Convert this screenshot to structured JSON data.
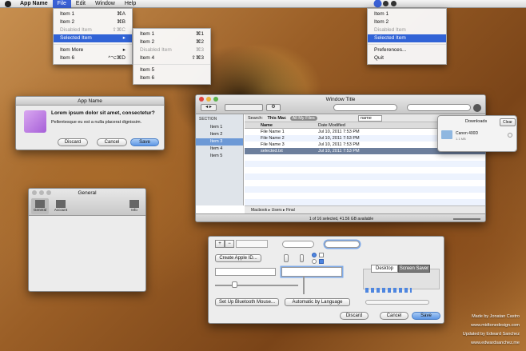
{
  "menubar": {
    "app_name": "App Name",
    "items": [
      "File",
      "Edit",
      "Window",
      "Help"
    ]
  },
  "file_menu": {
    "items": [
      {
        "label": "Item 1",
        "shortcut": "⌘A"
      },
      {
        "label": "Item 2",
        "shortcut": "⌘B"
      },
      {
        "label": "Disabled Item",
        "shortcut": "⇧⌘C"
      },
      {
        "label": "Selected Item",
        "shortcut": "▸"
      },
      {
        "label": "Item More",
        "shortcut": "▸"
      },
      {
        "label": "Item 6",
        "shortcut": "^⌥⌘D"
      }
    ]
  },
  "sub_menu": {
    "items": [
      {
        "label": "Item 1",
        "shortcut": "⌘1"
      },
      {
        "label": "Item 2",
        "shortcut": "⌘2"
      },
      {
        "label": "Disabled Item",
        "shortcut": "⌘3"
      },
      {
        "label": "Item 4",
        "shortcut": "⇧⌘3"
      },
      {
        "label": "Item 5",
        "shortcut": ""
      },
      {
        "label": "Item 6",
        "shortcut": ""
      }
    ]
  },
  "tray_menu": {
    "items": [
      "Item 1",
      "Item 2",
      "Disabled Item",
      "Selected Item",
      "Preferences...",
      "Quit"
    ]
  },
  "alert": {
    "title": "App Name",
    "heading": "Lorem ipsum dolor sit amet, consectetur?",
    "body": "Pellentesque eu est a nulla placerat dignissim.",
    "discard": "Discard",
    "cancel": "Cancel",
    "save": "Save"
  },
  "prefs": {
    "title": "General",
    "tabs": [
      "General",
      "Account",
      "Info"
    ]
  },
  "finder": {
    "title": "Window Title",
    "section": "SECTION",
    "sidebar": [
      "Item 1",
      "Item 2",
      "Item 3",
      "Item 4",
      "Item 5"
    ],
    "search_label": "Search:",
    "scope": [
      "This Mac",
      "All My Files"
    ],
    "filter": "name",
    "columns": [
      "Name",
      "Date Modified"
    ],
    "rows": [
      {
        "name": "File Name 1",
        "date": "Jul 10, 2011 7:53 PM"
      },
      {
        "name": "File Name 2",
        "date": "Jul 10, 2011 7:53 PM"
      },
      {
        "name": "File Name 3",
        "date": "Jul 10, 2011 7:53 PM"
      },
      {
        "name": "selected.txt",
        "date": "Jul 10, 2011 7:53 PM"
      }
    ],
    "path": [
      "Macbook",
      "Users",
      "Final"
    ],
    "status": "1 of 16 selected, 41.56 GB available"
  },
  "downloads": {
    "title": "Downloads",
    "clear": "Clear",
    "item_name": "Canon 400D",
    "item_size": "1.1 MB"
  },
  "controls": {
    "plus": "+",
    "minus": "−",
    "create_button": "Create Apple ID...",
    "segments": [
      "Desktop",
      "Screen Saver"
    ],
    "bluetooth_button": "Set Up Bluetooth Mouse...",
    "popup": "Automatic by Language",
    "discard": "Discard",
    "cancel": "Cancel",
    "save": "Save"
  },
  "credits": [
    "Made by Jonatan Castro",
    "www.midtonedesign.com",
    "Updated by Edward Sanchez",
    "www.edwardsanchez.me"
  ],
  "colors": {
    "accent": "#3163d6"
  }
}
